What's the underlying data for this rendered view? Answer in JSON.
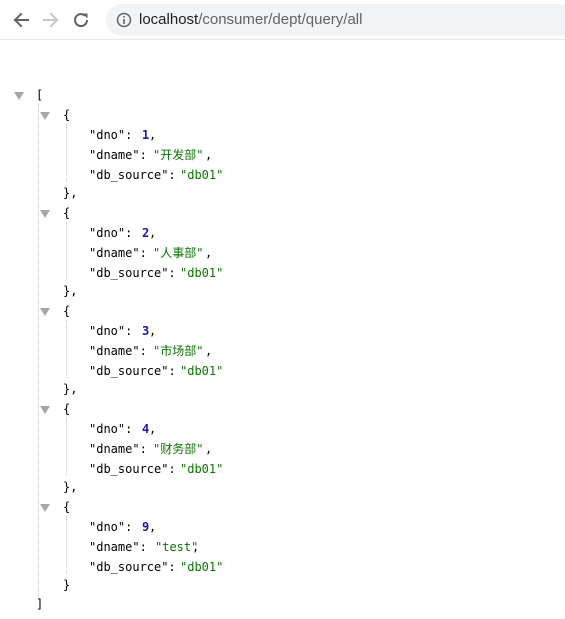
{
  "browser": {
    "url_host": "localhost",
    "url_path": "/consumer/dept/query/all",
    "icons": {
      "back": "arrow-left-icon",
      "forward": "arrow-right-icon",
      "reload": "reload-icon",
      "site_info": "info-circle-icon"
    },
    "colors": {
      "nav_active": "#5f6368",
      "nav_disabled": "#c6c6c6",
      "omnibox_bg": "#f1f3f4"
    }
  },
  "json": {
    "open_bracket": "[",
    "close_bracket": "]",
    "open_brace": "{",
    "close_brace_comma": "},",
    "close_brace": "}",
    "comma": ",",
    "keys": {
      "dno": "\"dno\":",
      "dname": "\"dname\":",
      "db_source": "\"db_source\":"
    },
    "items": [
      {
        "dno": "1",
        "dname": "\"开发部\"",
        "db_source": "\"db01\""
      },
      {
        "dno": "2",
        "dname": "\"人事部\"",
        "db_source": "\"db01\""
      },
      {
        "dno": "3",
        "dname": "\"市场部\"",
        "db_source": "\"db01\""
      },
      {
        "dno": "4",
        "dname": "\"财务部\"",
        "db_source": "\"db01\""
      },
      {
        "dno": "9",
        "dname": "\"test\"",
        "db_source": "\"db01\""
      }
    ],
    "colors": {
      "number": "#1a1aa6",
      "string": "#0b7500",
      "triangle": "#a6a6a6"
    }
  }
}
